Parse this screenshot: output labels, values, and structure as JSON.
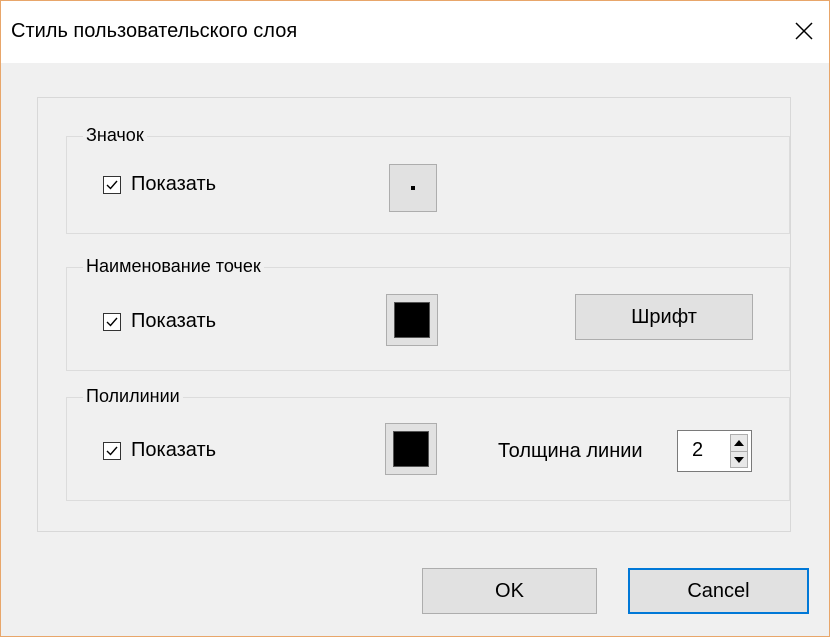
{
  "dialog": {
    "title": "Стиль пользовательского слоя",
    "close_icon": "close-icon"
  },
  "symbol_group": {
    "title": "Значок",
    "show_label": "Показать",
    "show_checked": true
  },
  "labels_group": {
    "title": "Наименование точек",
    "show_label": "Показать",
    "show_checked": true,
    "color": "#000000",
    "font_button": "Шрифт"
  },
  "polyline_group": {
    "title": "Полилинии",
    "show_label": "Показать",
    "show_checked": true,
    "color": "#000000",
    "width_label": "Толщина линии",
    "width_value": "2"
  },
  "buttons": {
    "ok": "OK",
    "cancel": "Cancel"
  }
}
